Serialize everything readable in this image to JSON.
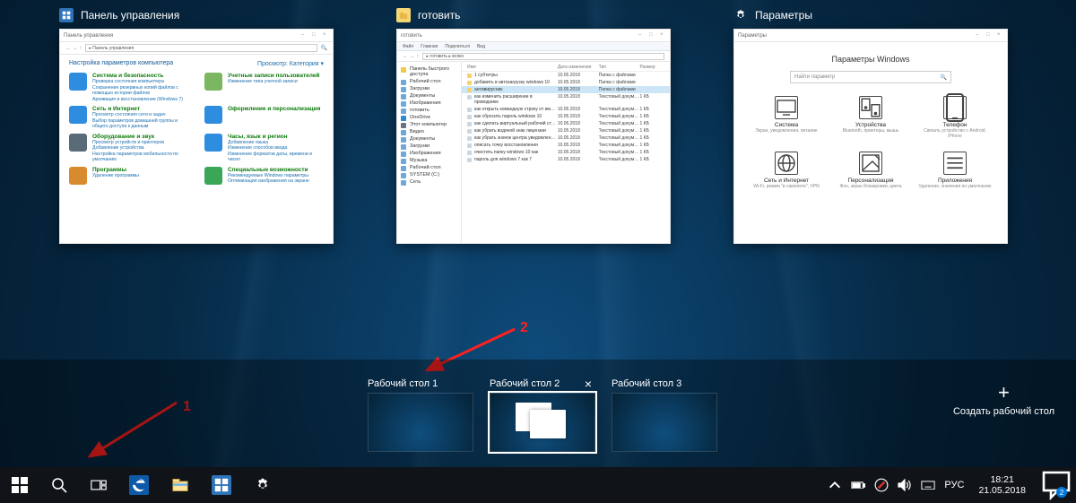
{
  "apps": [
    {
      "title": "Панель управления",
      "icon_color": "#2e73b8",
      "addressbar": "Панель управления",
      "heading": "Настройка параметров компьютера",
      "view_label": "Просмотр:   Категория ▾",
      "categories": [
        {
          "title": "Система и безопасность",
          "links": "Проверка состояния компьютера\nСохранение резервных копий файлов с помощью истории файлов\nАрхивация и восстановление (Windows 7)",
          "color": "#2f8de0"
        },
        {
          "title": "Учетные записи пользователей",
          "links": "Изменение типа учетной записи",
          "color": "#7bb661"
        },
        {
          "title": "Сеть и Интернет",
          "links": "Просмотр состояния сети и задач\nВыбор параметров домашней группы и общего доступа к данным",
          "color": "#2f8de0"
        },
        {
          "title": "Оформление и персонализация",
          "links": "",
          "color": "#2f8de0"
        },
        {
          "title": "Оборудование и звук",
          "links": "Просмотр устройств и принтеров\nДобавление устройства\nНастройка параметров мобильности по умолчанию",
          "color": "#5a6b78"
        },
        {
          "title": "Часы, язык и регион",
          "links": "Добавление языка\nИзменение способов ввода\nИзменение форматов даты, времени и чисел",
          "color": "#2f8de0"
        },
        {
          "title": "Программы",
          "links": "Удаление программы",
          "color": "#d88b2e"
        },
        {
          "title": "Специальные возможности",
          "links": "Рекомендуемые Windows параметры\nОптимизация изображения на экране",
          "color": "#3aa757"
        }
      ]
    },
    {
      "title": "готовить",
      "icon_color": "#f8d775",
      "ribbon": [
        "Файл",
        "Главная",
        "Поделиться",
        "Вид"
      ],
      "addressbar": "готовить",
      "columns": [
        "Имя",
        "Дата изменения",
        "Тип",
        "Размер"
      ],
      "sidegroups": [
        {
          "name": "Панель быстрого доступа",
          "cls": "star"
        },
        {
          "name": "Рабочий стол",
          "cls": ""
        },
        {
          "name": "Загрузки",
          "cls": ""
        },
        {
          "name": "Документы",
          "cls": ""
        },
        {
          "name": "Изображения",
          "cls": ""
        },
        {
          "name": "готовить",
          "cls": ""
        },
        {
          "name": "OneDrive",
          "cls": "onedrive"
        },
        {
          "name": "Этот компьютер",
          "cls": "pc"
        },
        {
          "name": "Видео",
          "cls": ""
        },
        {
          "name": "Документы",
          "cls": ""
        },
        {
          "name": "Загрузки",
          "cls": ""
        },
        {
          "name": "Изображения",
          "cls": ""
        },
        {
          "name": "Музыка",
          "cls": ""
        },
        {
          "name": "Рабочий стол",
          "cls": ""
        },
        {
          "name": "SYSTEM (C:)",
          "cls": ""
        },
        {
          "name": "Сеть",
          "cls": ""
        }
      ],
      "rows": [
        {
          "n": "1 субтитры",
          "d": "10.05.2018",
          "t": "Папка с файлами",
          "s": ""
        },
        {
          "n": "добавить в автозагрузку windows 10",
          "d": "10.05.2018",
          "t": "Папка с файлами",
          "s": ""
        },
        {
          "n": "антивирусник",
          "d": "10.05.2018",
          "t": "Папка с файлами",
          "s": "",
          "sel": true
        },
        {
          "n": "как изменить расширение в проводнике",
          "d": "10.05.2018",
          "t": "Текстовый докум…",
          "s": "1 КБ"
        },
        {
          "n": "как открыть командную строку от им…",
          "d": "10.05.2018",
          "t": "Текстовый докум…",
          "s": "1 КБ"
        },
        {
          "n": "как сбросить пароль windows 10",
          "d": "10.05.2018",
          "t": "Текстовый докум…",
          "s": "1 КБ"
        },
        {
          "n": "как сделать виртуальный рабочий ст…",
          "d": "10.05.2018",
          "t": "Текстовый докум…",
          "s": "1 КБ"
        },
        {
          "n": "как убрать водяной знак лицензии",
          "d": "10.05.2018",
          "t": "Текстовый докум…",
          "s": "1 КБ"
        },
        {
          "n": "как убрать значок центра уведомлен…",
          "d": "10.05.2018",
          "t": "Текстовый докум…",
          "s": "1 КБ"
        },
        {
          "n": "описать точку восстановления",
          "d": "10.05.2018",
          "t": "Текстовый докум…",
          "s": "1 КБ"
        },
        {
          "n": "очистить папку windows 10 как",
          "d": "10.05.2018",
          "t": "Текстовый докум…",
          "s": "1 КБ"
        },
        {
          "n": "пароль для windows 7 как 7",
          "d": "10.05.2018",
          "t": "Текстовый докум…",
          "s": "1 КБ"
        }
      ]
    },
    {
      "title": "Параметры",
      "icon_color": "#ffffff",
      "window_label": "Параметры",
      "main_title": "Параметры Windows",
      "search_placeholder": "Найти параметр",
      "tiles": [
        {
          "t": "Система",
          "s": "Экран, уведомления, питание"
        },
        {
          "t": "Устройства",
          "s": "Bluetooth, принтеры, мышь"
        },
        {
          "t": "Телефон",
          "s": "Связать устройство с Android, iPhone"
        },
        {
          "t": "Сеть и Интернет",
          "s": "Wi-Fi, режим \"в самолете\", VPN"
        },
        {
          "t": "Персонализация",
          "s": "Фон, экран блокировки, цвета"
        },
        {
          "t": "Приложения",
          "s": "Удаление, значения по умолчанию"
        }
      ]
    }
  ],
  "desktops": [
    {
      "label": "Рабочий стол 1",
      "active": false,
      "closeable": false
    },
    {
      "label": "Рабочий стол 2",
      "active": true,
      "closeable": true
    },
    {
      "label": "Рабочий стол 3",
      "active": false,
      "closeable": false
    }
  ],
  "new_desktop_label": "Создать рабочий стол",
  "annotations": {
    "one": "1",
    "two": "2"
  },
  "taskbar": {
    "lang": "РУС",
    "time": "18:21",
    "date": "21.05.2018",
    "notif_count": "2"
  }
}
